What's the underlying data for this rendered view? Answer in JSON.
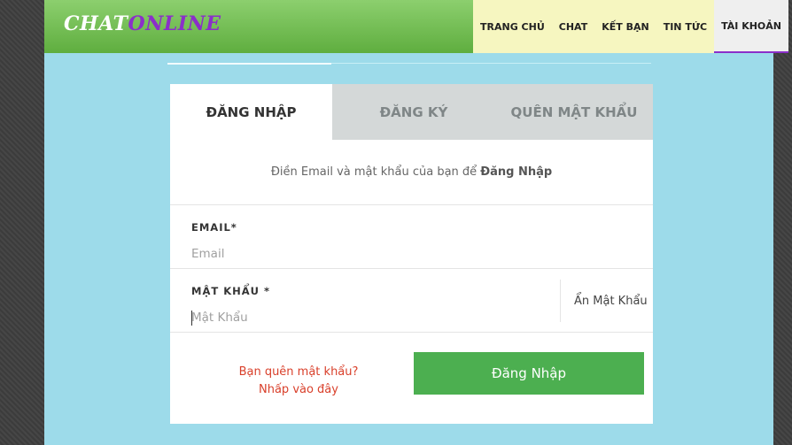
{
  "logo": {
    "part1": "CHAT",
    "part2": "ONLINE"
  },
  "nav": {
    "items": [
      {
        "label": "TRANG CHỦ"
      },
      {
        "label": "CHAT"
      },
      {
        "label": "KẾT BẠN"
      },
      {
        "label": "TIN TỨC"
      },
      {
        "label": "TÀI KHOẢN",
        "active": true
      }
    ]
  },
  "tabs": [
    {
      "label": "ĐĂNG NHẬP",
      "active": true
    },
    {
      "label": "ĐĂNG KÝ"
    },
    {
      "label": "QUÊN MẬT KHẨU"
    }
  ],
  "intro": {
    "text": "Điền Email và mật khẩu của bạn để",
    "bold": "Đăng Nhập"
  },
  "email": {
    "label": "EMAIL*",
    "placeholder": "Email",
    "value": ""
  },
  "password": {
    "label": "MẬT KHẨU *",
    "placeholder": "Mật Khẩu",
    "value": "",
    "toggle": "Ẩn Mật Khẩu"
  },
  "forgot": {
    "line1": "Bạn quên mật khẩu?",
    "line2": "Nhấp vào đây"
  },
  "login_button": "Đăng Nhập",
  "colors": {
    "header_green": "#5fae3f",
    "logo_purple": "#8b2fc9",
    "nav_bg": "#f6f6c0",
    "page_bg": "#9ddbea",
    "button_green": "#4caf50",
    "link_red": "#d9402b",
    "inactive_tab": "#d4d8d8"
  }
}
